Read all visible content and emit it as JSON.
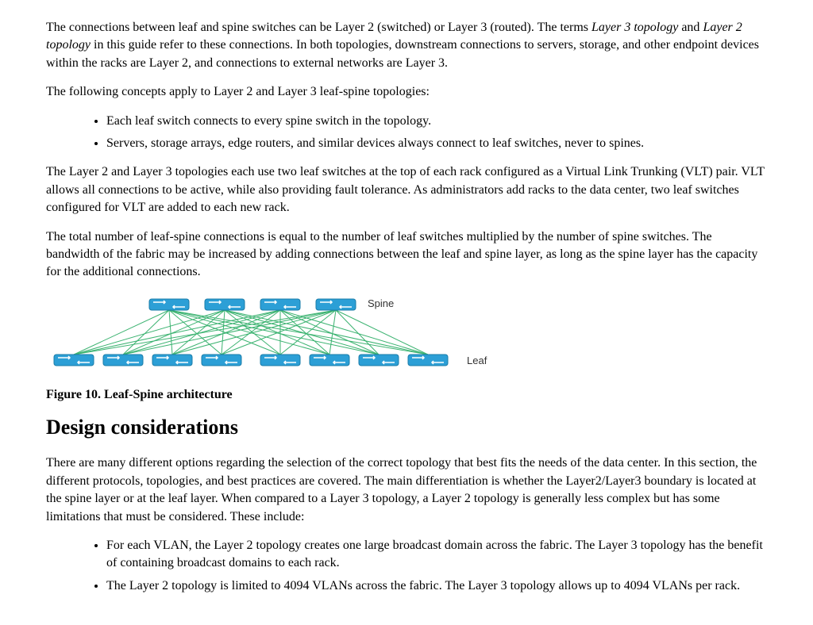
{
  "para1": {
    "pre": "The connections between leaf and spine switches can be Layer 2 (switched) or Layer 3 (routed). The terms ",
    "em1": "Layer 3 topology",
    "mid": " and ",
    "em2": "Layer 2 topology",
    "post": " in this guide refer to these connections. In both topologies, downstream connections to servers, storage, and other endpoint devices within the racks are Layer 2, and connections to external networks are Layer 3."
  },
  "para2": "The following concepts apply to Layer 2 and Layer 3 leaf-spine topologies:",
  "list1": {
    "i0": "Each leaf switch connects to every spine switch in the topology.",
    "i1": "Servers, storage arrays, edge routers, and similar devices always connect to leaf switches, never to spines."
  },
  "para3": "The Layer 2 and Layer 3 topologies each use two leaf switches at the top of each rack configured as a Virtual Link Trunking (VLT) pair. VLT allows all connections to be active, while also providing fault tolerance. As administrators add racks to the data center, two leaf switches configured for VLT are added to each new rack.",
  "para4": "The total number of leaf-spine connections is equal to the number of leaf switches multiplied by the number of spine switches. The bandwidth of the fabric may be increased by adding connections between the leaf and spine layer, as long as the spine layer has the capacity for the additional connections.",
  "diagram": {
    "spine_label": "Spine",
    "leaf_label": "Leaf",
    "colors": {
      "switch_fill": "#2c9fd6",
      "switch_stroke": "#1a7ca8",
      "link": "#3cb371"
    }
  },
  "figure_caption": "Figure 10. Leaf-Spine architecture",
  "heading": "Design considerations",
  "para5": "There are many different options regarding the selection of the correct topology that best fits the needs of the data center. In this section, the different protocols, topologies, and best practices are covered. The main differentiation is whether the Layer2/Layer3 boundary is located at the spine layer or at the leaf layer. When compared to a Layer 3 topology, a Layer 2 topology is generally less complex but has some limitations that must be considered. These include:",
  "list2": {
    "i0": "For each VLAN, the Layer 2 topology creates one large broadcast domain across the fabric. The Layer 3 topology has the benefit of containing broadcast domains to each rack.",
    "i1": "The Layer 2 topology is limited to 4094 VLANs across the fabric. The Layer 3 topology allows up to 4094 VLANs per rack."
  }
}
